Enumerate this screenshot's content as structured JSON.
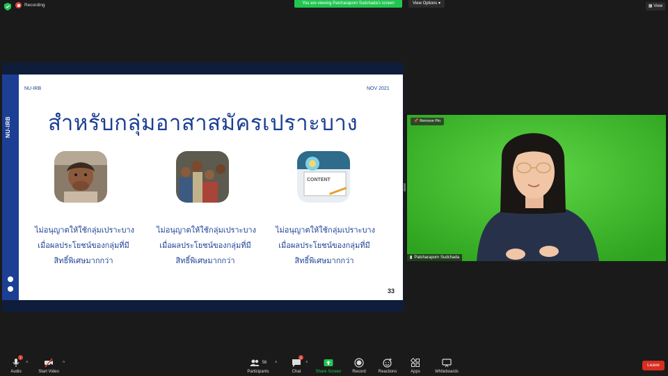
{
  "topbar": {
    "recording_label": "Recording",
    "viewing_banner": "You are viewing Patcharaporn Sudchada's screen",
    "view_options_label": "View Options",
    "view_label": "View"
  },
  "slide": {
    "side_label": "NU-IRB",
    "corner_left": "NU-IRB",
    "corner_right": "NOV 2021",
    "title": "สำหรับกลุ่มอาสาสมัครเปราะบาง",
    "caption_line1": "ไม่อนุญาตให้ใช้กลุ่มเปราะบาง",
    "caption_line2": "เมื่อผลประโยชน์ของกลุ่มที่มี",
    "caption_line3": "สิทธิ์พิเศษมากกว่า",
    "page_number": "33",
    "content_card_text": "CONTENT"
  },
  "video": {
    "remove_pin_label": "Remove Pin",
    "participant_name": "Patcharaporn Sudchada"
  },
  "toolbar": {
    "audio_label": "Audio",
    "start_video_label": "Start Video",
    "participants_label": "Participants",
    "participants_count": "56",
    "chat_label": "Chat",
    "chat_badge": "1",
    "share_screen_label": "Share Screen",
    "record_label": "Record",
    "reactions_label": "Reactions",
    "apps_label": "Apps",
    "whiteboards_label": "Whiteboards",
    "leave_label": "Leave",
    "audio_badge": "!"
  },
  "colors": {
    "slide_blue": "#1c3f93",
    "share_green": "#23c552",
    "leave_red": "#d92d20",
    "greenscreen": "#3fbf2c"
  }
}
